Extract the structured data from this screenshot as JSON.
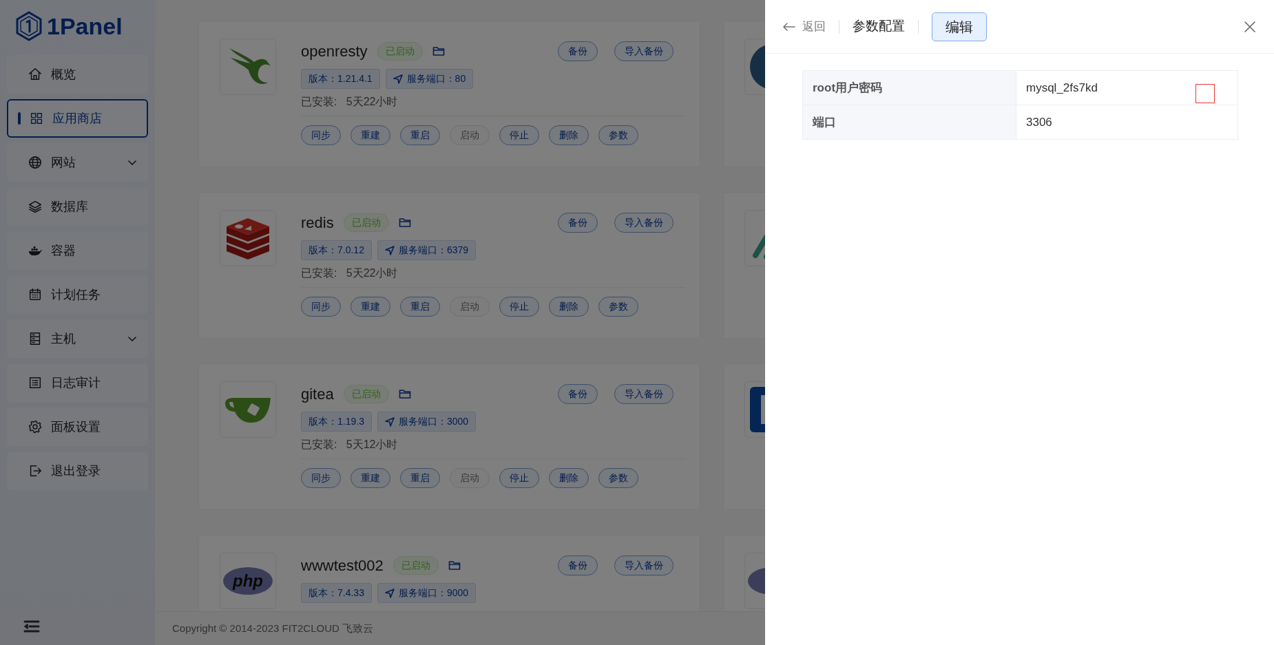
{
  "sidebar": {
    "logo": "1Panel",
    "items": [
      {
        "label": "概览",
        "kind": "home",
        "selected": false,
        "expandable": false
      },
      {
        "label": "应用商店",
        "kind": "grid",
        "selected": true,
        "expandable": false
      },
      {
        "label": "网站",
        "kind": "globe",
        "selected": false,
        "expandable": true
      },
      {
        "label": "数据库",
        "kind": "layers",
        "selected": false,
        "expandable": false
      },
      {
        "label": "容器",
        "kind": "whale",
        "selected": false,
        "expandable": false
      },
      {
        "label": "计划任务",
        "kind": "calendar",
        "selected": false,
        "expandable": false
      },
      {
        "label": "主机",
        "kind": "server",
        "selected": false,
        "expandable": true
      },
      {
        "label": "日志审计",
        "kind": "list",
        "selected": false,
        "expandable": false
      },
      {
        "label": "面板设置",
        "kind": "gear",
        "selected": false,
        "expandable": false
      },
      {
        "label": "退出登录",
        "kind": "logout",
        "selected": false,
        "expandable": false
      }
    ]
  },
  "apps": [
    {
      "kind": "openresty",
      "name": "openresty",
      "status": "已启动",
      "top_actions": [
        "备份",
        "导入备份"
      ],
      "version": "版本：1.21.4.1",
      "port": "服务端口：80",
      "installed": "已安装:   5天22小时",
      "actions": [
        {
          "label": "同步",
          "disabled": false
        },
        {
          "label": "重建",
          "disabled": false
        },
        {
          "label": "重启",
          "disabled": false
        },
        {
          "label": "启动",
          "disabled": true
        },
        {
          "label": "停止",
          "disabled": false
        },
        {
          "label": "删除",
          "disabled": false
        },
        {
          "label": "参数",
          "disabled": false
        }
      ]
    },
    {
      "kind": "redis",
      "name": "redis",
      "status": "已启动",
      "top_actions": [
        "备份",
        "导入备份"
      ],
      "version": "版本：7.0.12",
      "port": "服务端口：6379",
      "installed": "已安装:   5天22小时",
      "actions": [
        {
          "label": "同步",
          "disabled": false
        },
        {
          "label": "重建",
          "disabled": false
        },
        {
          "label": "重启",
          "disabled": false
        },
        {
          "label": "启动",
          "disabled": true
        },
        {
          "label": "停止",
          "disabled": false
        },
        {
          "label": "删除",
          "disabled": false
        },
        {
          "label": "参数",
          "disabled": false
        }
      ]
    },
    {
      "kind": "gitea",
      "name": "gitea",
      "status": "已启动",
      "top_actions": [
        "备份",
        "导入备份"
      ],
      "version": "版本：1.19.3",
      "port": "服务端口：3000",
      "installed": "已安装:   5天12小时",
      "actions": [
        {
          "label": "同步",
          "disabled": false
        },
        {
          "label": "重建",
          "disabled": false
        },
        {
          "label": "重启",
          "disabled": false
        },
        {
          "label": "启动",
          "disabled": true
        },
        {
          "label": "停止",
          "disabled": false
        },
        {
          "label": "删除",
          "disabled": false
        },
        {
          "label": "参数",
          "disabled": false
        }
      ]
    },
    {
      "kind": "php",
      "logo_text": "php",
      "name": "wwwtest002",
      "status": "已启动",
      "top_actions": [
        "备份",
        "导入备份"
      ],
      "version": "版本：7.4.33",
      "port": "服务端口：9000"
    }
  ],
  "side_apps": [
    {
      "kind": "mysql"
    },
    {
      "kind": "stripes"
    },
    {
      "kind": "bluebox"
    },
    {
      "kind": "php"
    }
  ],
  "footer": "Copyright © 2014-2023 FIT2CLOUD 飞致云",
  "drawer": {
    "back": "返回",
    "title": "参数配置",
    "edit": "编辑",
    "rows": [
      {
        "label": "root用户密码",
        "value": "mysql_2fs7kd",
        "marked": true
      },
      {
        "label": "端口",
        "value": "3306",
        "marked": false
      }
    ]
  }
}
